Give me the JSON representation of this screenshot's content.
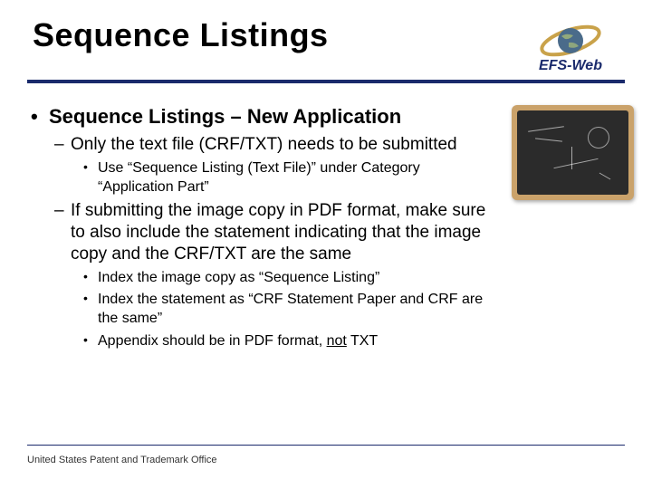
{
  "title": "Sequence Listings",
  "logo": {
    "text": "EFS-Web"
  },
  "bullets": {
    "main": "Sequence Listings – New Application",
    "sub1": "Only the text file (CRF/TXT) needs to be submitted",
    "sub1a": "Use “Sequence Listing (Text File)” under Category “Application Part”",
    "sub2": "If submitting the image copy in PDF format, make sure to also include the statement indicating that the image copy and the CRF/TXT are the same",
    "sub2a": "Index the image copy as “Sequence Listing”",
    "sub2b": "Index the statement as “CRF Statement Paper and CRF are the same”",
    "sub2c_prefix": "Appendix should be in PDF format, ",
    "sub2c_not": "not",
    "sub2c_suffix": " TXT"
  },
  "footer": "United States Patent and Trademark Office"
}
